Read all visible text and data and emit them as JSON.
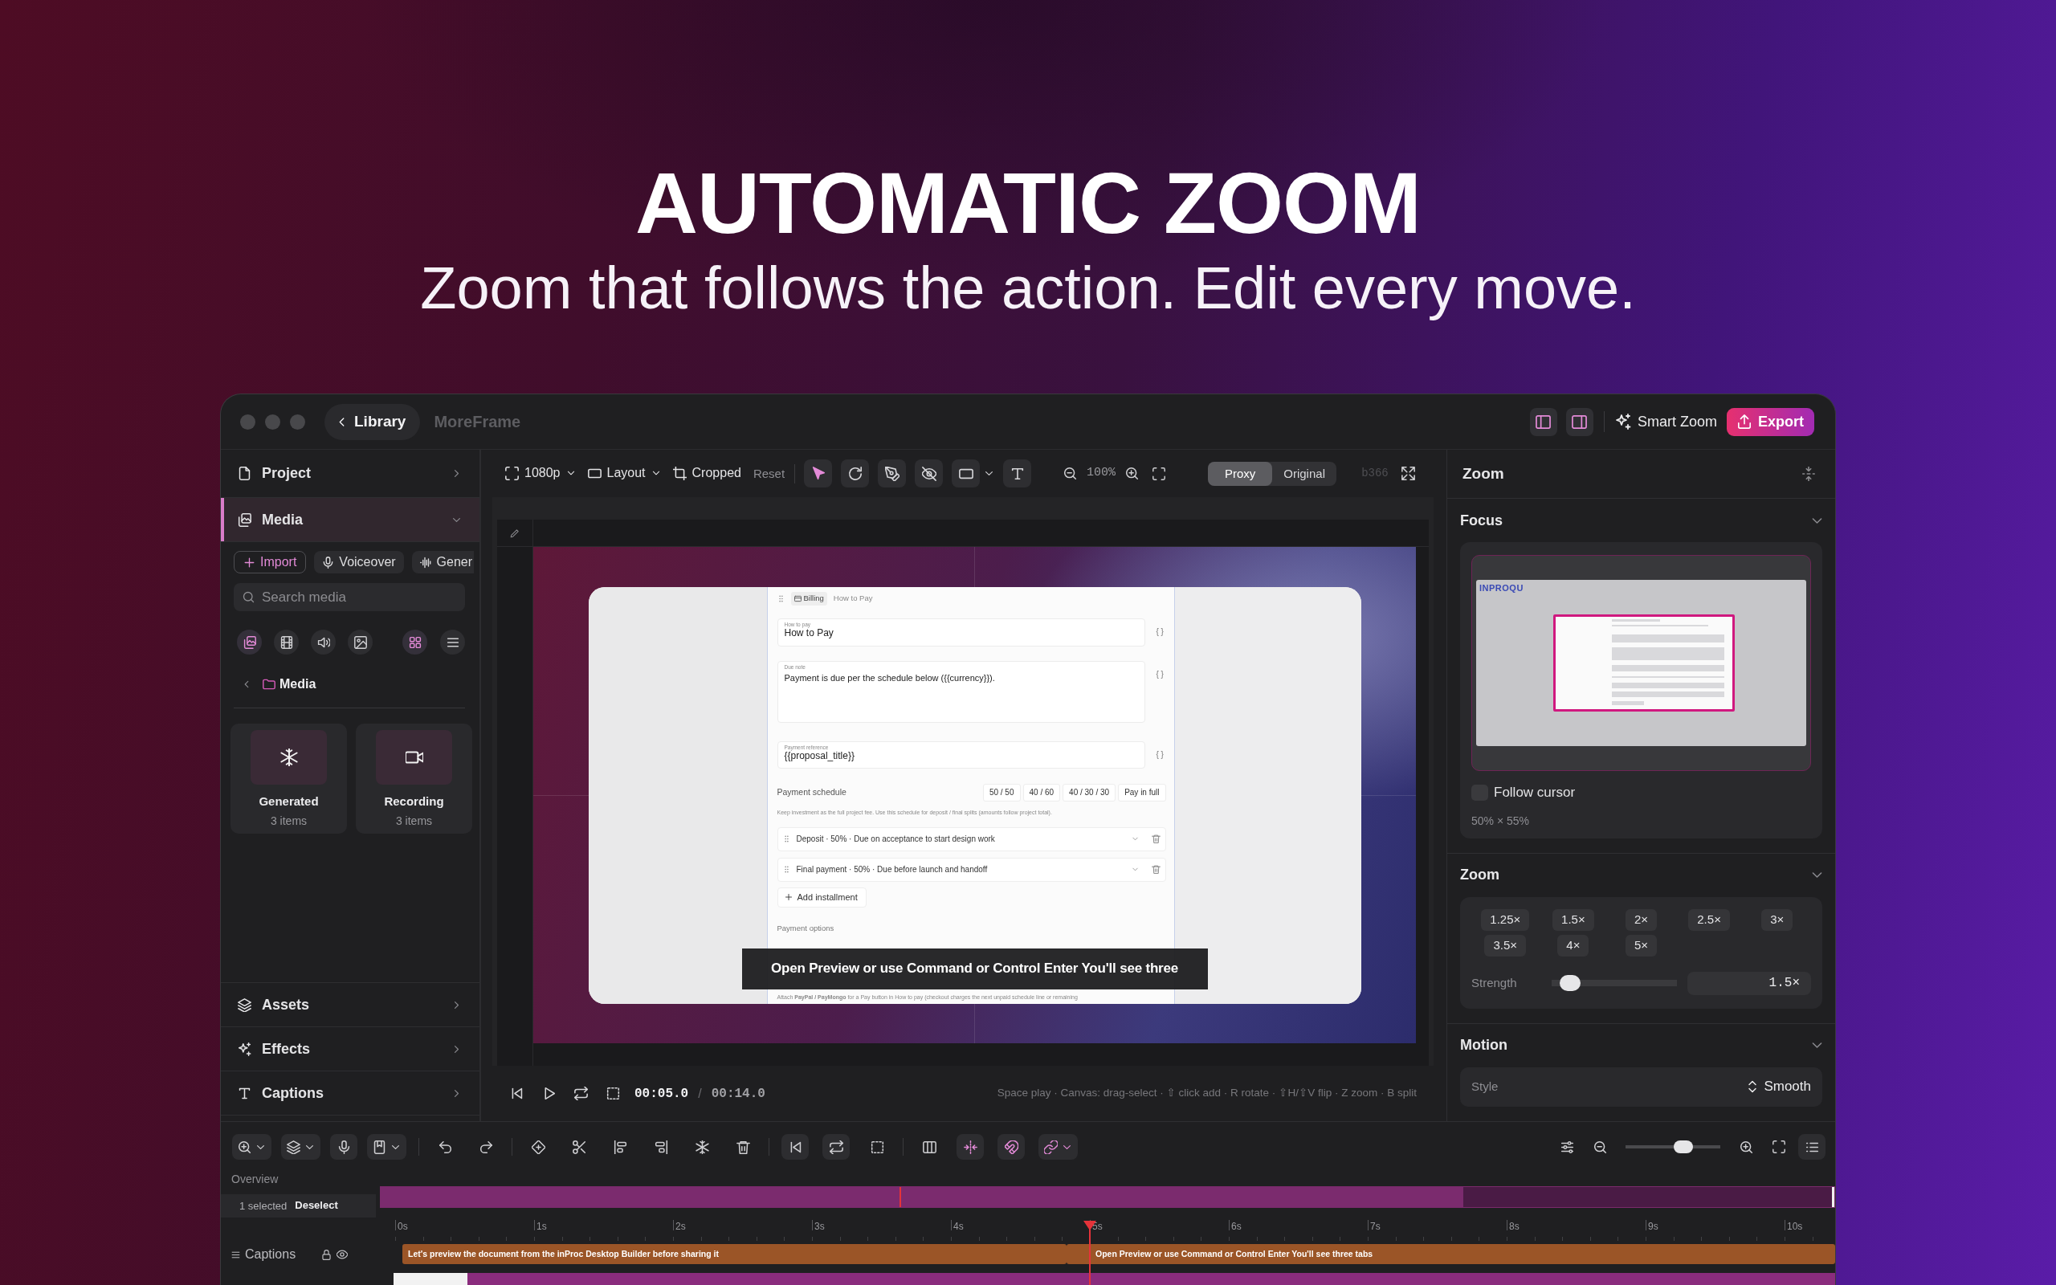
{
  "hero": {
    "title": "AUTOMATIC ZOOM",
    "subtitle": "Zoom that follows the action. Edit every move."
  },
  "titlebar": {
    "back": "Library",
    "project": "MoreFrame",
    "panel_toggles": [
      {
        "kind": "left",
        "on": true
      },
      {
        "kind": "right",
        "on": true
      }
    ],
    "smart_zoom": "Smart Zoom",
    "export": "Export"
  },
  "sidebar": {
    "panels": [
      {
        "kind": "project",
        "label": "Project",
        "expanded": false,
        "selected": false
      },
      {
        "kind": "media",
        "label": "Media",
        "expanded": true,
        "selected": true
      },
      {
        "kind": "assets",
        "label": "Assets",
        "expanded": false,
        "selected": false
      },
      {
        "kind": "effects",
        "label": "Effects",
        "expanded": false,
        "selected": false
      },
      {
        "kind": "captions",
        "label": "Captions",
        "expanded": false,
        "selected": false
      }
    ],
    "media": {
      "actions": [
        {
          "kind": "import",
          "label": "Import"
        },
        {
          "kind": "voiceover",
          "label": "Voiceover"
        },
        {
          "kind": "generate",
          "label": "Gener"
        }
      ],
      "search": {
        "placeholder": "Search media"
      },
      "filters": [
        {
          "kind": "all",
          "selected": true
        },
        {
          "kind": "video",
          "selected": false
        },
        {
          "kind": "audio",
          "selected": false
        },
        {
          "kind": "image",
          "selected": false
        }
      ],
      "views": [
        {
          "kind": "grid",
          "selected": true
        },
        {
          "kind": "list",
          "selected": false
        }
      ],
      "folder": "Media",
      "items": [
        {
          "kind": "generated",
          "name": "Generated",
          "count": "3 items"
        },
        {
          "kind": "recording",
          "name": "Recording",
          "count": "3 items"
        }
      ]
    }
  },
  "canvas_toolbar": {
    "resolution": "1080p",
    "layout": "Layout",
    "crop": "Cropped",
    "reset": "Reset",
    "tools": [
      {
        "kind": "select",
        "selected": true,
        "menu": false
      },
      {
        "kind": "rotate",
        "selected": false,
        "menu": false
      },
      {
        "kind": "pen",
        "selected": false,
        "menu": false
      },
      {
        "kind": "hide",
        "selected": false,
        "menu": false
      },
      {
        "kind": "shape",
        "selected": false,
        "menu": true
      },
      {
        "kind": "text",
        "selected": false,
        "menu": false
      }
    ],
    "zoom": "100%",
    "sources": [
      {
        "label": "Proxy",
        "selected": true
      },
      {
        "label": "Original",
        "selected": false
      }
    ],
    "build": "b366"
  },
  "preview": {
    "crumbs": [
      {
        "kind": "section",
        "label": "Billing"
      },
      {
        "kind": "page",
        "label": "How to Pay"
      }
    ],
    "fields": [
      {
        "kind": "input",
        "label": "How to pay",
        "value": "How to Pay",
        "insert": "{ }"
      },
      {
        "kind": "textarea",
        "label": "Due note",
        "value": "Payment is due per the schedule below ({{currency}}).",
        "insert": "{ }"
      },
      {
        "kind": "input",
        "label": "Payment reference",
        "value": "{{proposal_title}}",
        "insert": "{ }"
      }
    ],
    "schedule": {
      "label": "Payment schedule",
      "presets": [
        "50 / 50",
        "40 / 60",
        "40 / 30 / 30",
        "Pay in full"
      ],
      "note": "Keep investment as the full project fee. Use this schedule for deposit / final splits (amounts follow project total).",
      "installments": [
        "Deposit · 50% · Due on acceptance to start design work",
        "Final payment · 50% · Due before launch and handoff"
      ],
      "add": "Add installment"
    },
    "options_label": "Payment options",
    "footnote": "Attach **PayPal / PayMongo** for a Pay button in How to pay (checkout charges the next unpaid schedule line or remaining",
    "caption": "Open Preview or use Command or Control Enter You'll see three"
  },
  "playback": {
    "current": "00:05.0",
    "separator": "/",
    "total": "00:14.0",
    "hints": "Space play · Canvas: drag-select · ⇧ click add · R rotate · ⇧H/⇧V flip · Z zoom · B split"
  },
  "inspector": {
    "title": "Zoom",
    "sections": [
      {
        "kind": "focus",
        "title": "Focus",
        "expanded": true
      },
      {
        "kind": "zoom",
        "title": "Zoom",
        "expanded": true
      },
      {
        "kind": "motion",
        "title": "Motion",
        "expanded": true
      }
    ],
    "focus": {
      "logo": "INPROQU",
      "follow_cursor": {
        "label": "Follow cursor",
        "checked": false
      },
      "size": "50% × 55%"
    },
    "zoom": {
      "presets": [
        "1.25×",
        "1.5×",
        "2×",
        "2.5×",
        "3×",
        "3.5×",
        "4×",
        "5×"
      ],
      "strength": {
        "label": "Strength",
        "level": 0.15,
        "value": "1.5×"
      }
    },
    "motion": {
      "style": {
        "label": "Style",
        "value": "Smooth"
      }
    }
  },
  "timeline": {
    "tools": [
      [
        {
          "kind": "zoom",
          "menu": true,
          "on": false
        },
        {
          "kind": "layers",
          "menu": true,
          "on": false
        },
        {
          "kind": "mic",
          "menu": false,
          "on": false
        },
        {
          "kind": "bookmark",
          "menu": true,
          "on": false
        }
      ],
      [
        {
          "kind": "undo",
          "menu": false,
          "on": false
        },
        {
          "kind": "redo",
          "menu": false,
          "on": false
        }
      ],
      [
        {
          "kind": "keyframe",
          "menu": false,
          "on": false
        },
        {
          "kind": "cut",
          "menu": false,
          "on": false
        },
        {
          "kind": "align-start",
          "menu": false,
          "on": false
        },
        {
          "kind": "align-end",
          "menu": false,
          "on": false
        },
        {
          "kind": "freeze",
          "menu": false,
          "on": false
        },
        {
          "kind": "delete",
          "menu": false,
          "on": false
        }
      ],
      [
        {
          "kind": "to-start",
          "menu": false,
          "on": false
        },
        {
          "kind": "loop",
          "menu": false,
          "on": false
        },
        {
          "kind": "region",
          "menu": false,
          "on": false
        }
      ],
      [
        {
          "kind": "columns",
          "menu": false,
          "on": false
        },
        {
          "kind": "split",
          "menu": false,
          "on": true
        },
        {
          "kind": "snap",
          "menu": false,
          "on": true
        },
        {
          "kind": "link",
          "menu": true,
          "on": true
        }
      ]
    ],
    "scale": {
      "level": 0.61
    },
    "overview": "Overview",
    "selection": {
      "count": "1 selected",
      "action": "Deselect"
    },
    "playhead": {
      "level": 0.357
    },
    "ruler": [
      "0s",
      "1s",
      "2s",
      "3s",
      "4s",
      "5s",
      "6s",
      "7s",
      "8s",
      "9s",
      "10s"
    ],
    "tracks": [
      {
        "kind": "captions",
        "label": "Captions",
        "clips": [
          "Let's preview the document from the inProc Desktop Builder before sharing it",
          "Open Preview or use Command or Control Enter You'll see three tabs"
        ]
      }
    ]
  }
}
